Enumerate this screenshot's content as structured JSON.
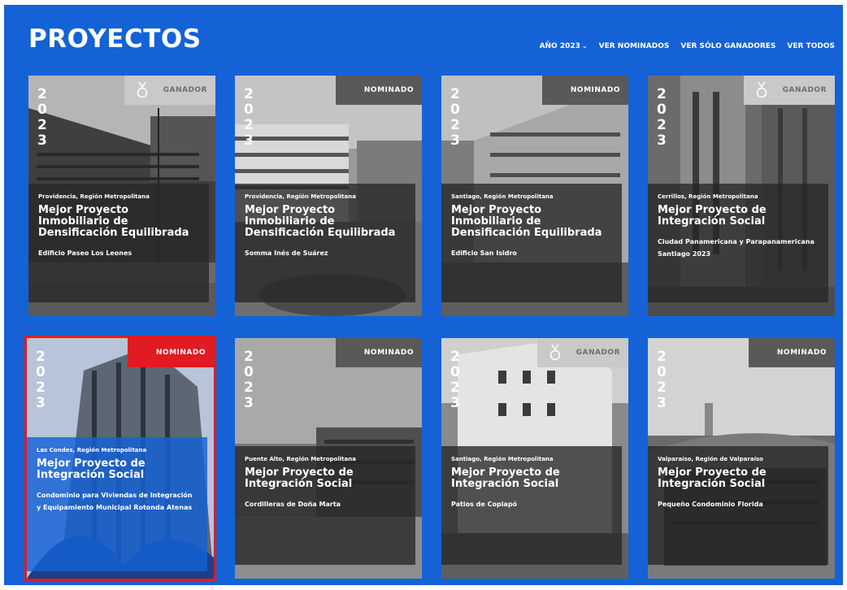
{
  "header": {
    "title": "PROYECTOS",
    "nav": {
      "year_filter": "AÑO 2023",
      "nominated": "VER NOMINADOS",
      "winners": "VER SÓLO GANADORES",
      "all": "VER TODOS"
    }
  },
  "year_digits": [
    "2",
    "0",
    "2",
    "3"
  ],
  "cards": [
    {
      "badge": "GANADOR",
      "location": "Providencia, Región Metropolitana",
      "category": "Mejor Proyecto Inmobiliario de Densificación Equilibrada",
      "project": "Edificio Paseo Los Leones"
    },
    {
      "badge": "NOMINADO",
      "location": "Providencia, Región Metropolitana",
      "category": "Mejor Proyecto Inmobiliario de Densificación Equilibrada",
      "project": "Somma Inés de Suárez"
    },
    {
      "badge": "NOMINADO",
      "location": "Santiago, Región Metropolitana",
      "category": "Mejor Proyecto Inmobiliario de Densificación Equilibrada",
      "project": "Edificio San Isidro"
    },
    {
      "badge": "GANADOR",
      "location": "Cerrillos, Región Metropolitana",
      "category": "Mejor Proyecto de Integración Social",
      "project": "Ciudad Panamericana y Parapanamericana Santiago 2023"
    },
    {
      "badge": "NOMINADO",
      "location": "Las Condes, Región Metropolitana",
      "category": "Mejor Proyecto de Integración Social",
      "project": "Condominio para Viviendas de Integración y Equipamiento Municipal Rotonda Atenas"
    },
    {
      "badge": "NOMINADO",
      "location": "Puente Alto, Región Metropolitana",
      "category": "Mejor Proyecto de Integración Social",
      "project": "Cordilleras de Doña Marta"
    },
    {
      "badge": "GANADOR",
      "location": "Santiago, Región Metropolitana",
      "category": "Mejor Proyecto de Integración Social",
      "project": "Patios de Copiapó"
    },
    {
      "badge": "NOMINADO",
      "location": "Valparaíso, Región de Valparaíso",
      "category": "Mejor Proyecto de Integración Social",
      "project": "Pequeño Condominio Florida"
    }
  ],
  "colors": {
    "background": "#1462d6",
    "nominated_badge": "#595959",
    "selected_badge": "#e01b22",
    "winner_badge": "#c9c9c9",
    "selected_outline": "#e01b22"
  },
  "icons": {
    "winner": "medal-icon",
    "year_filter_chevron": "chevron-down-icon"
  }
}
